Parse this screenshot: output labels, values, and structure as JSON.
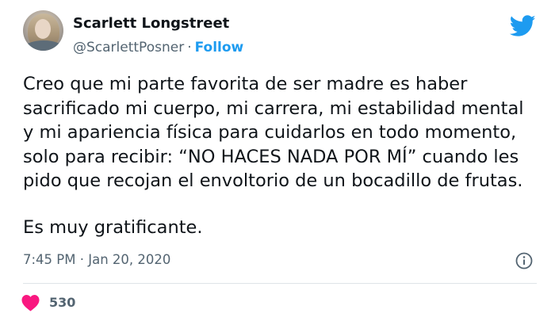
{
  "user": {
    "name": "Scarlett Longstreet",
    "handle": "@ScarlettPosner",
    "separator": "·",
    "follow_label": "Follow"
  },
  "tweet": {
    "lines": [
      "Creo que mi parte favorita de ser madre es haber",
      "sacrificado mi cuerpo, mi carrera, mi estabilidad mental",
      "y mi apariencia física para cuidarlos en todo momento,",
      "solo para recibir: “NO HACES NADA POR MÍ” cuando les",
      "pido que recojan el envoltorio de un bocadillo de frutas."
    ],
    "closing": "Es muy gratificante."
  },
  "meta": {
    "timestamp": "7:45 PM · Jan 20, 2020"
  },
  "engagement": {
    "like_count": "530"
  },
  "icons": {
    "logo": "twitter-bird-icon",
    "info": "info-icon",
    "like": "heart-icon"
  },
  "colors": {
    "brand": "#1d9bf0",
    "like": "#f91880",
    "text": "#0f1419",
    "muted": "#536471"
  }
}
